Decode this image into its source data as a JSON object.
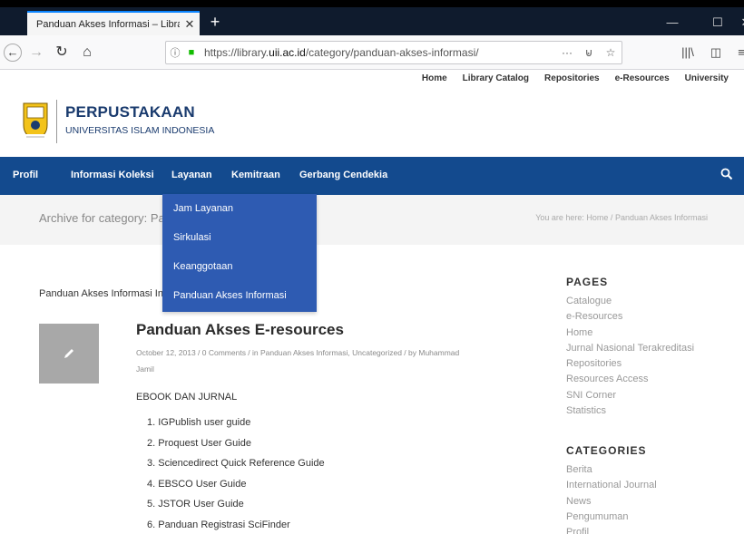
{
  "browser": {
    "tab_title": "Panduan Akses Informasi – Library",
    "url_prefix": "https://library.",
    "url_domain": "uii.ac.id",
    "url_path": "/category/panduan-akses-informasi/"
  },
  "site": {
    "utility_nav": [
      "Home",
      "Library Catalog",
      "Repositories",
      "e-Resources",
      "University"
    ],
    "logo": {
      "title": "PERPUSTAKAAN",
      "subtitle": "UNIVERSITAS ISLAM INDONESIA"
    },
    "main_nav": [
      "Profil",
      "Informasi Koleksi",
      "Layanan",
      "Kemitraan",
      "Gerbang Cendekia"
    ],
    "dropdown": [
      "Jam Layanan",
      "Sirkulasi",
      "Keanggotaan",
      "Panduan Akses Informasi"
    ],
    "archive_title": "Archive for category: Pa",
    "breadcrumb": "You are here: Home / Panduan Akses Informasi",
    "intro_text": "Panduan Akses Informasi In",
    "post": {
      "title": "Panduan Akses E-resources",
      "meta": "October 12, 2013 / 0 Comments / in Panduan Akses Informasi, Uncategorized / by Muhammad Jamil",
      "section": "EBOOK DAN JURNAL",
      "items": [
        "1. IGPublish user guide",
        "2. Proquest User Guide",
        "3. Sciencedirect Quick Reference Guide",
        "4. EBSCO User Guide",
        "5. JSTOR User Guide",
        "6. Panduan Registrasi SciFinder"
      ]
    },
    "sidebar": {
      "pages_heading": "PAGES",
      "pages": [
        "Catalogue",
        "e-Resources",
        "Home",
        "Jurnal Nasional Terakreditasi",
        "Repositories",
        "Resources Access",
        "SNI Corner",
        "Statistics"
      ],
      "categories_heading": "CATEGORIES",
      "categories": [
        "Berita",
        "International Journal",
        "News",
        "Pengumuman",
        "Profil"
      ]
    }
  },
  "colors": {
    "nav_blue": "#134a8e",
    "dropdown_blue": "#2e5bb2",
    "lock_green": "#12bc00"
  }
}
